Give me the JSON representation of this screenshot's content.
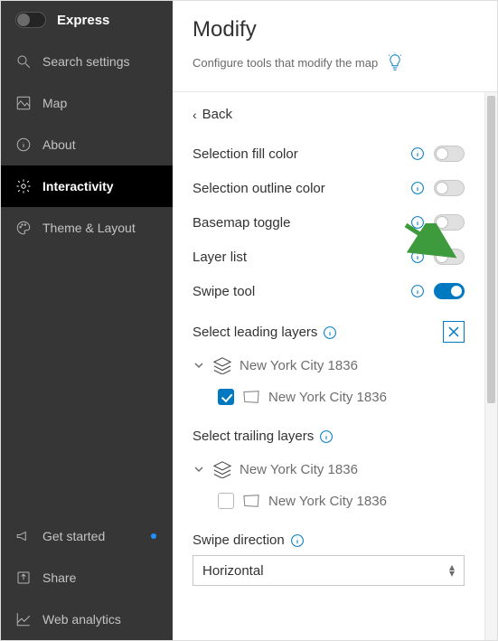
{
  "sidebar": {
    "brand": "Express",
    "items": [
      {
        "label": "Search settings"
      },
      {
        "label": "Map"
      },
      {
        "label": "About"
      },
      {
        "label": "Interactivity"
      },
      {
        "label": "Theme & Layout"
      }
    ],
    "footer": [
      {
        "label": "Get started",
        "dot": true
      },
      {
        "label": "Share"
      },
      {
        "label": "Web analytics"
      }
    ]
  },
  "header": {
    "title": "Modify",
    "subtitle": "Configure tools that modify the map"
  },
  "back": "Back",
  "settings": [
    {
      "label": "Selection fill color",
      "on": false
    },
    {
      "label": "Selection outline color",
      "on": false
    },
    {
      "label": "Basemap toggle",
      "on": false
    },
    {
      "label": "Layer list",
      "on": false
    },
    {
      "label": "Swipe tool",
      "on": true
    }
  ],
  "leading_heading": "Select leading layers",
  "trailing_heading": "Select trailing layers",
  "direction_label": "Swipe direction",
  "direction_value": "Horizontal",
  "leading_layers": {
    "group": "New York City 1836",
    "child": "New York City 1836",
    "child_checked": true
  },
  "trailing_layers": {
    "group": "New York City 1836",
    "child": "New York City 1836",
    "child_checked": false
  }
}
